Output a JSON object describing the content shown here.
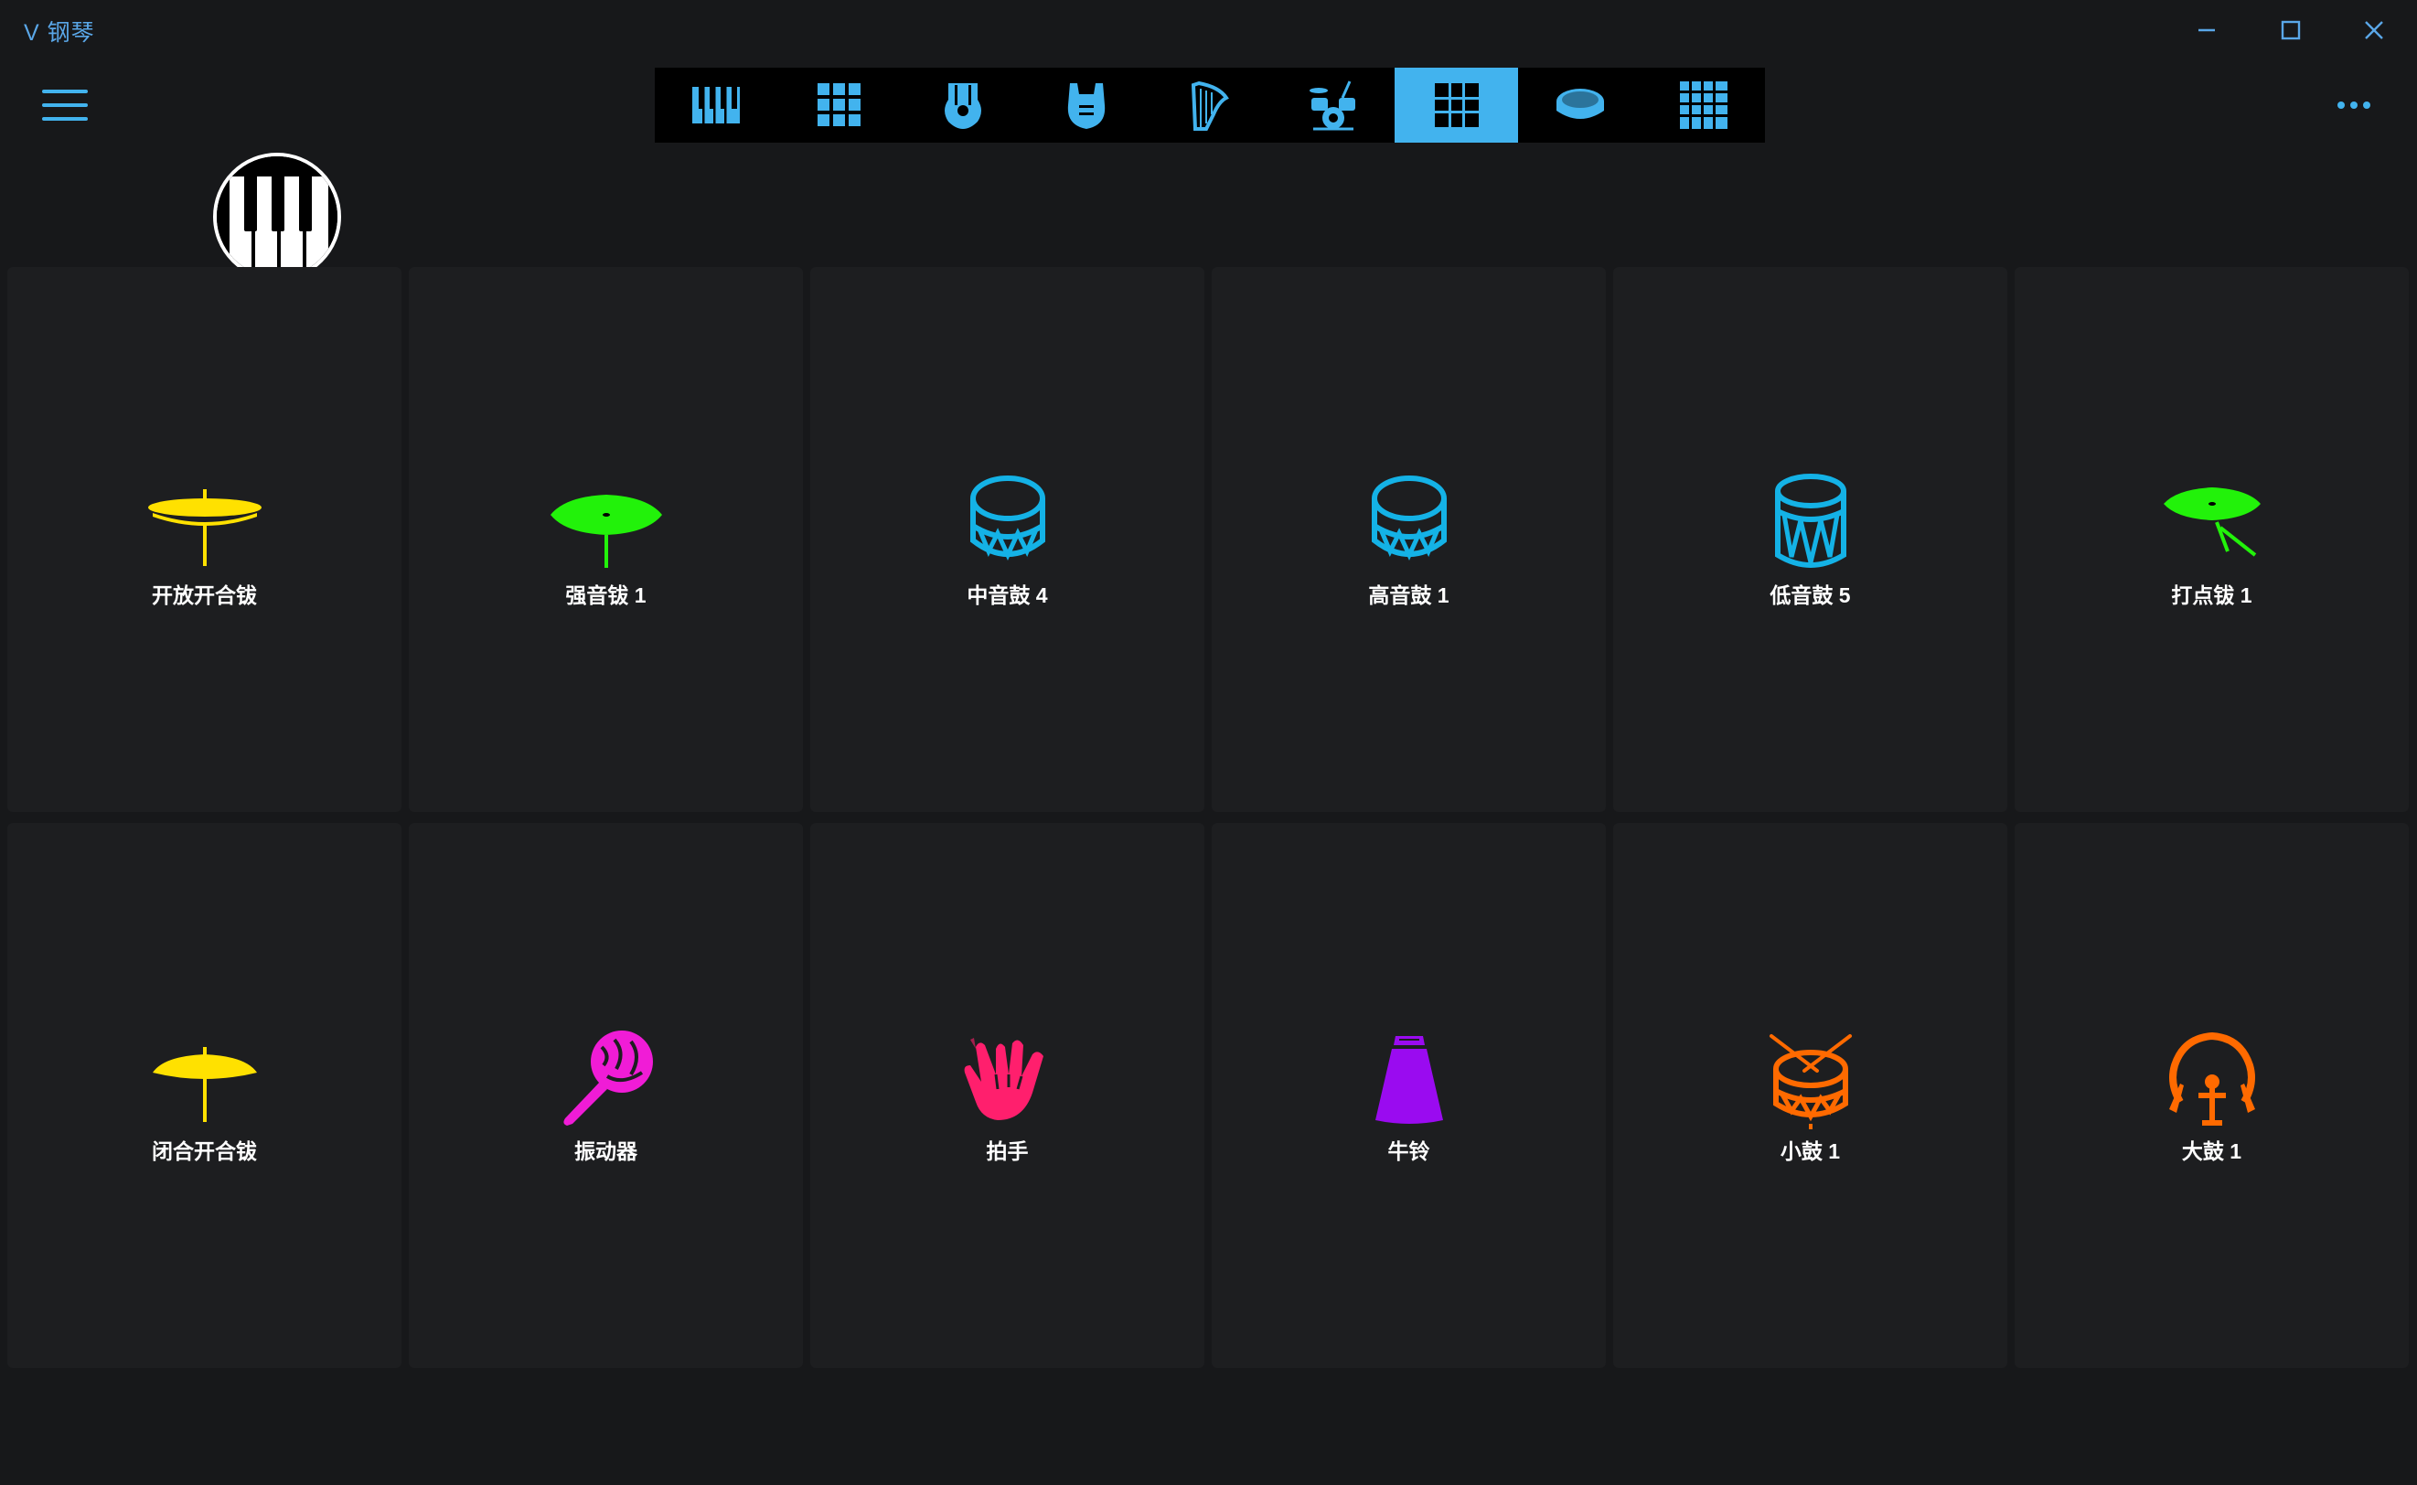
{
  "app": {
    "title": "V 钢琴"
  },
  "window_controls": {
    "minimize": "minimize-icon",
    "maximize": "maximize-icon",
    "close": "close-icon"
  },
  "colors": {
    "accent": "#42b3ee",
    "yellow": "#ffe100",
    "green": "#22f20a",
    "blue": "#14b2e6",
    "magenta": "#f01cd6",
    "pink": "#ff1f6d",
    "purple": "#9a0bf0",
    "orange": "#ff6a00"
  },
  "toolbar": {
    "selected_index": 6,
    "items": [
      {
        "icon": "piano-keys-icon"
      },
      {
        "icon": "pads-grid-icon"
      },
      {
        "icon": "acoustic-guitar-icon"
      },
      {
        "icon": "electric-guitar-icon"
      },
      {
        "icon": "harp-icon"
      },
      {
        "icon": "drum-kit-icon"
      },
      {
        "icon": "drum-pads-icon"
      },
      {
        "icon": "single-drum-icon"
      },
      {
        "icon": "large-grid-icon"
      }
    ]
  },
  "pads": [
    {
      "label": "开放开合钹",
      "icon": "hihat-open-icon",
      "color": "#ffe100"
    },
    {
      "label": "强音钹 1",
      "icon": "crash-cymbal-icon",
      "color": "#22f20a"
    },
    {
      "label": "中音鼓 4",
      "icon": "mid-tom-icon",
      "color": "#14b2e6"
    },
    {
      "label": "高音鼓 1",
      "icon": "high-tom-icon",
      "color": "#14b2e6"
    },
    {
      "label": "低音鼓 5",
      "icon": "low-tom-icon",
      "color": "#14b2e6"
    },
    {
      "label": "打点钹 1",
      "icon": "ride-cymbal-icon",
      "color": "#22f20a"
    },
    {
      "label": "闭合开合钹",
      "icon": "hihat-closed-icon",
      "color": "#ffe100"
    },
    {
      "label": "振动器",
      "icon": "maraca-icon",
      "color": "#f01cd6"
    },
    {
      "label": "拍手",
      "icon": "clap-icon",
      "color": "#ff1f6d"
    },
    {
      "label": "牛铃",
      "icon": "cowbell-icon",
      "color": "#9a0bf0"
    },
    {
      "label": "小鼓 1",
      "icon": "snare-drum-icon",
      "color": "#ff6a00"
    },
    {
      "label": "大鼓 1",
      "icon": "bass-drum-icon",
      "color": "#ff6a00"
    }
  ]
}
